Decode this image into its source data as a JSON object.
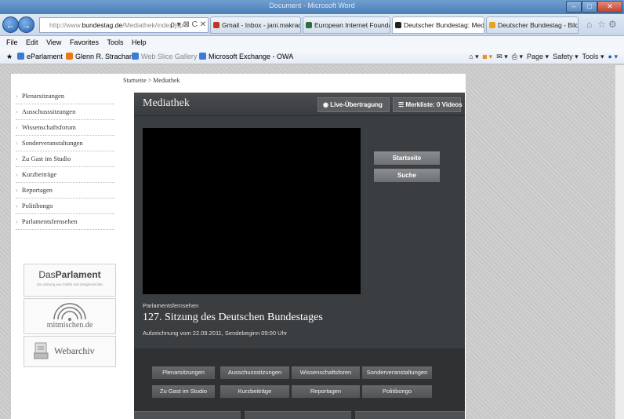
{
  "browser": {
    "window_title": "Document - Microsoft Word",
    "address": {
      "prefix": "http://www.",
      "domain": "bundestag.de",
      "path": "/Mediathek/index.jsp",
      "controls": "ρ ▾ ⊠ C ✕"
    },
    "tabs": [
      {
        "label": "Gmail - Inbox - jani.makraduli...",
        "color": "#c23321"
      },
      {
        "label": "European Internet Foundation",
        "color": "#2c6e3f"
      },
      {
        "label": "Deutscher Bundestag: Medi...",
        "color": "#222222",
        "close": "✕"
      },
      {
        "label": "Deutscher Bundestag - Bilderdi...",
        "color": "#e8a21c"
      }
    ],
    "menu": [
      "File",
      "Edit",
      "View",
      "Favorites",
      "Tools",
      "Help"
    ],
    "favorites": [
      {
        "label": "eParlament",
        "color": "#3a7bd5"
      },
      {
        "label": "Glenn R. Strachan",
        "color": "#e57c12"
      },
      {
        "label": "Web Slice Gallery ▾",
        "color": "#3a7bd5"
      },
      {
        "label": "Microsoft Exchange - OWA",
        "color": "#3a7bd5"
      }
    ],
    "commands": [
      "Page ▾",
      "Safety ▾",
      "Tools ▾"
    ]
  },
  "page": {
    "breadcrumb": "Startseite > Mediathek",
    "sidebar": [
      "Plenarsitzungen",
      "Ausschusssitzungen",
      "Wissenschaftsforum",
      "Sonderveranstaltungen",
      "Zu Gast im Studio",
      "Kurzbeiträge",
      "Reportagen",
      "Politibongo",
      "Parlamentsfernsehen"
    ],
    "logos": {
      "parlament_light": "Das",
      "parlament_bold": "Parlament",
      "parlament_sub": "Die Zeitung aus Politik und Zeitgeschichte",
      "mitmischen": "mitmischen.de",
      "webarchiv": "Webarchiv"
    },
    "title": "Mediathek",
    "live_button": "Live-Übertragung",
    "merkliste_button": "Merkliste:  0 Videos",
    "side_buttons": [
      "Startseite",
      "Suche"
    ],
    "video": {
      "category": "Parlamentsfernsehen",
      "title": "127. Sitzung des Deutschen Bundestages",
      "info": "Aufzeichnung vom 22.09.2011, Sendebeginn 09:00 Uhr"
    },
    "categories_row1": [
      "Plenarsitzungen",
      "Ausschusssitzungen",
      "Wissenschaftsforen",
      "Sonderveranstaltungen"
    ],
    "categories_row2": [
      "Zu Gast im Studio",
      "Kurzbeiträge",
      "Reportagen",
      "Politibongo"
    ]
  }
}
